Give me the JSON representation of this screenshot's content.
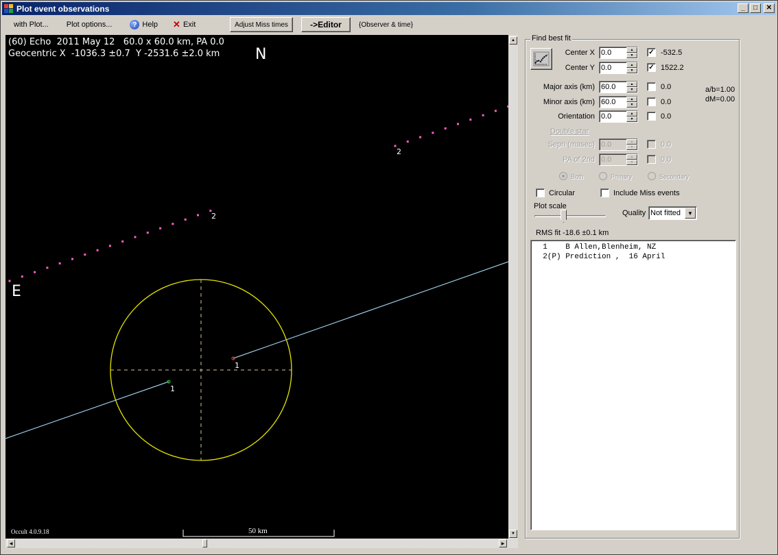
{
  "window": {
    "title": "Plot event observations",
    "controls": {
      "minimize": "_",
      "maximize": "□",
      "close": "✕"
    }
  },
  "menu": {
    "with_plot": "with Plot...",
    "plot_options": "Plot options...",
    "help": "Help",
    "exit": "Exit",
    "adjust_miss_times": "Adjust Miss times",
    "editor": "->Editor",
    "observer_time": "{Observer & time}"
  },
  "plot": {
    "header_line1": "(60) Echo  2011 May 12   60.0 x 60.0 km, PA 0.0",
    "header_line2": "Geocentric X  -1036.3 ±0.7  Y -2531.6 ±2.0 km",
    "north_label": "N",
    "east_label": "E",
    "version": "Occult 4.0.9.18",
    "scale_label": "50 km",
    "colors": {
      "background": "#000000",
      "ellipse": "#e6e600",
      "axes": "#d8c890",
      "chord": "#9ac8e0",
      "prediction_dots": "#ff60c0",
      "disappear_marker": "#20c020",
      "reappear_marker": "#d04040",
      "labels": "#ffffff"
    },
    "markers": [
      {
        "label": "1",
        "type": "disappear"
      },
      {
        "label": "1",
        "type": "reappear"
      },
      {
        "label": "2",
        "type": "prediction-limit"
      },
      {
        "label": "2",
        "type": "prediction-limit"
      }
    ]
  },
  "fit": {
    "legend": "Find best fit",
    "fit_button_icon": "fit-chart-icon",
    "rows": [
      {
        "label": "Center X",
        "value": "0.0",
        "checked": true,
        "result": "-532.5"
      },
      {
        "label": "Center Y",
        "value": "0.0",
        "checked": true,
        "result": "1522.2"
      },
      {
        "label": "Major axis (km)",
        "value": "60.0",
        "checked": false,
        "result": "0.0"
      },
      {
        "label": "Minor axis (km)",
        "value": "60.0",
        "checked": false,
        "result": "0.0"
      },
      {
        "label": "Orientation",
        "value": "0.0",
        "checked": false,
        "result": "0.0"
      }
    ],
    "ratio": "a/b=1.00",
    "dm": "dM=0.00",
    "double_star": {
      "label": "Double star",
      "rows": [
        {
          "label": "Sepn (masec)",
          "value": "0.0",
          "checked": false,
          "result": "0.0"
        },
        {
          "label": "PA of 2nd",
          "value": "0.0",
          "checked": false,
          "result": "0.0"
        }
      ],
      "radios": [
        {
          "label": "Both",
          "selected": true
        },
        {
          "label": "Primary",
          "selected": false
        },
        {
          "label": "Secondary",
          "selected": false
        }
      ]
    },
    "circular": {
      "label": "Circular",
      "checked": false
    },
    "include_miss": {
      "label": "Include Miss events",
      "checked": false
    },
    "plot_scale_label": "Plot scale",
    "plot_scale_value": 0.38,
    "quality_label": "Quality",
    "quality_value": "Not fitted",
    "rms": "RMS fit -18.6 ±0.1 km"
  },
  "observations": [
    "  1    B Allen,Blenheim, NZ",
    "  2(P) Prediction ,  16 April"
  ]
}
